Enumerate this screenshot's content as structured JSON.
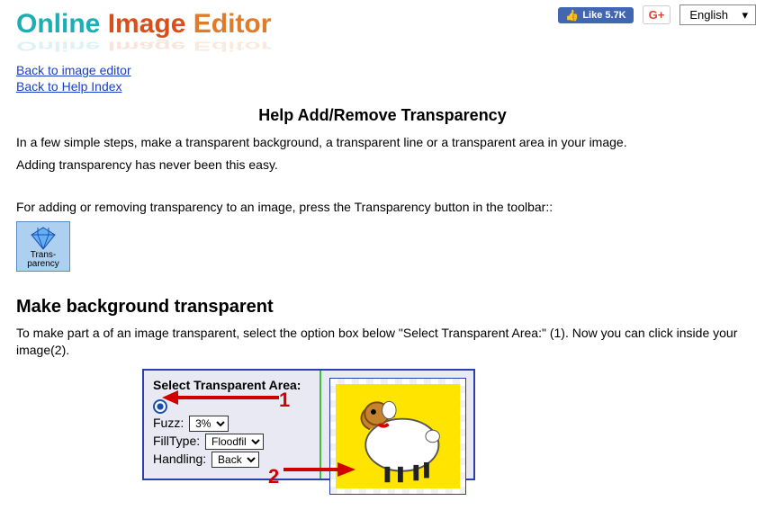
{
  "topbar": {
    "fb_like": "Like 5.7K",
    "gp": "G+",
    "language": "English"
  },
  "logo": {
    "w1": "Online",
    "w2": "Image",
    "w3": "Editor"
  },
  "nav": {
    "back_editor": "Back to image editor",
    "back_help": "Back to Help Index"
  },
  "title": "Help Add/Remove Transparency",
  "intro1": "In a few simple steps, make a transparent background, a transparent line or a transparent area in your image.",
  "intro2": "Adding transparency has never been this easy.",
  "para2": "For adding or removing transparency to an image, press the Transparency button in the toolbar::",
  "tool": {
    "label": "Trans-\nparency"
  },
  "section2": "Make background transparent",
  "section2_text": "To make part a of an image transparent, select the option box below \"Select Transparent Area:\" (1). Now you can click inside your image(2).",
  "panel": {
    "heading": "Select Transparent Area:",
    "fuzz_label": "Fuzz:",
    "fuzz_value": "3%",
    "filltype_label": "FillType:",
    "filltype_value": "Floodfil",
    "handling_label": "Handling:",
    "handling_value": "Back",
    "step1": "1",
    "step2": "2"
  }
}
